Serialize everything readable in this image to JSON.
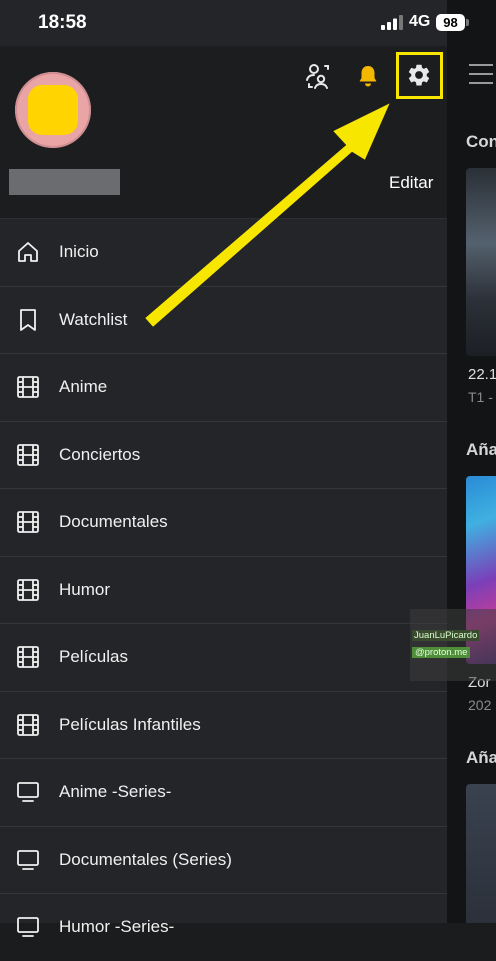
{
  "status_bar": {
    "time": "18:58",
    "network": "4G",
    "battery": "98"
  },
  "header": {
    "edit_label": "Editar"
  },
  "icons": {
    "profile": "switch-profile-icon",
    "notifications": "bell-icon",
    "settings": "gear-icon",
    "menu": "hamburger-icon"
  },
  "colors": {
    "accent_yellow": "#ffd400",
    "arrow": "#f7e600",
    "drawer_bg": "#242528"
  },
  "menu": {
    "items": [
      {
        "label": "Inicio",
        "icon": "home-icon"
      },
      {
        "label": "Watchlist",
        "icon": "bookmark-icon"
      },
      {
        "label": "Anime",
        "icon": "film-icon"
      },
      {
        "label": "Conciertos",
        "icon": "film-icon"
      },
      {
        "label": "Documentales",
        "icon": "film-icon"
      },
      {
        "label": "Humor",
        "icon": "film-icon"
      },
      {
        "label": "Películas",
        "icon": "film-icon"
      },
      {
        "label": "Películas Infantiles",
        "icon": "film-icon"
      },
      {
        "label": "Anime -Series-",
        "icon": "tv-icon"
      },
      {
        "label": "Documentales (Series)",
        "icon": "tv-icon"
      },
      {
        "label": "Humor -Series-",
        "icon": "tv-icon"
      }
    ]
  },
  "background": {
    "section1": "Con",
    "caption1": "22.1",
    "sub1": "T1 -",
    "section2": "Aña",
    "caption2": "Zor",
    "sub2": "202",
    "section3": "Aña"
  },
  "watermark": {
    "line1": "JuanLuPicardo",
    "line2": "@proton.me"
  }
}
